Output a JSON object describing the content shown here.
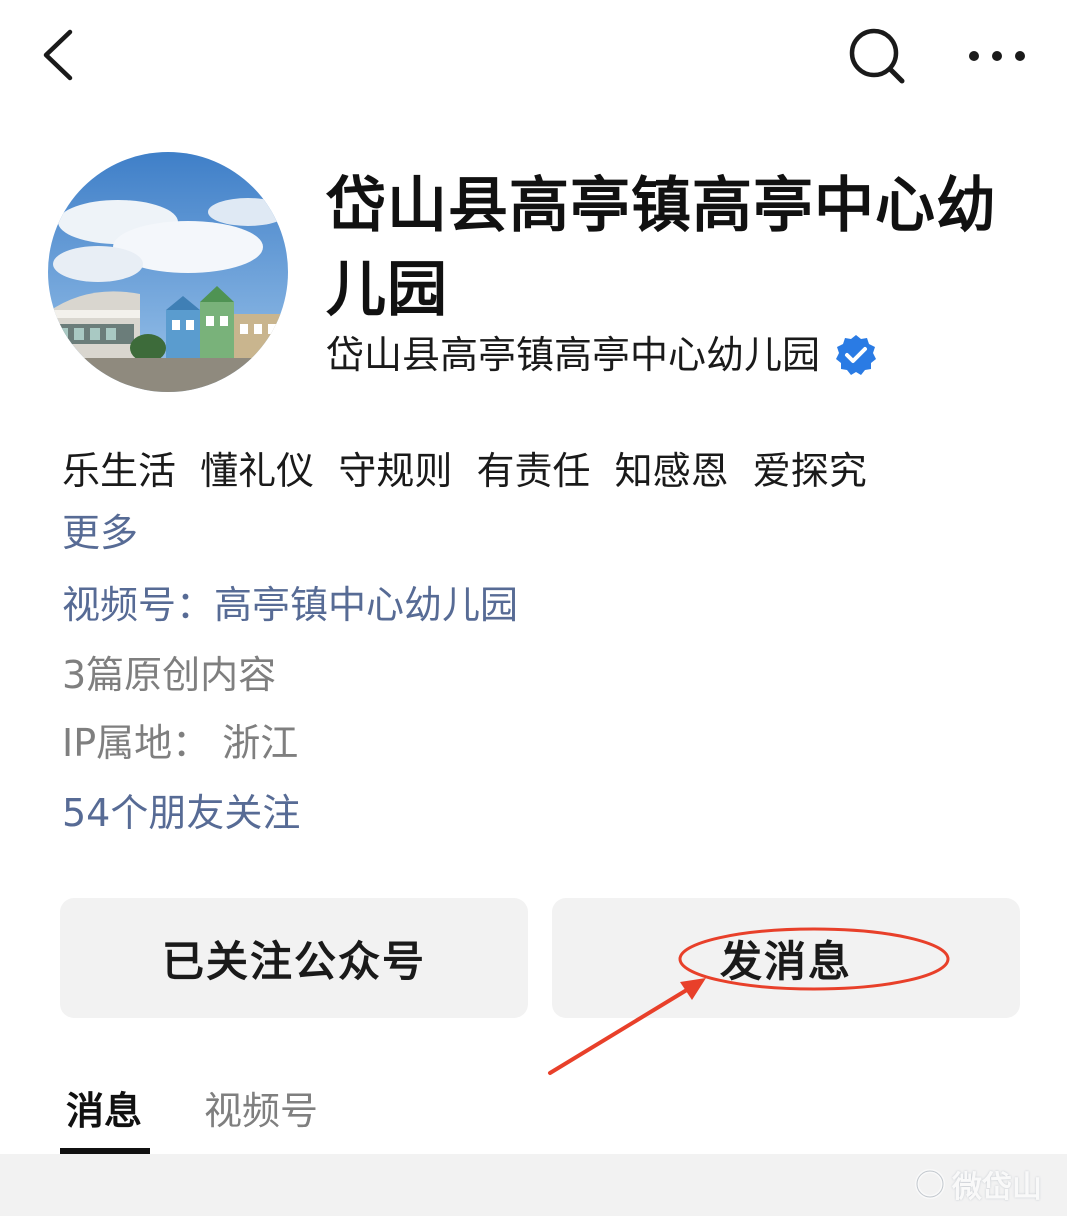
{
  "topbar": {
    "back_icon": "chevron-left-icon",
    "search_icon": "search-icon",
    "more_icon": "more-horizontal-icon"
  },
  "profile": {
    "account_name": "岱山县高亭镇高亭中心幼儿园",
    "subject_name": "岱山县高亭镇高亭中心幼儿园",
    "verified_icon": "verified-badge-icon",
    "verified_color": "#2a7be4",
    "slogan": "乐生活  懂礼仪  守规则  有责任  知感恩  爱探究",
    "more_label": "更多",
    "channel_label": "视频号：",
    "channel_name": "高亭镇中心幼儿园",
    "original_count": "3篇原创内容",
    "ip_location": "IP属地：  浙江",
    "friends_follow": "54个朋友关注"
  },
  "actions": {
    "followed_label": "已关注公众号",
    "message_label": "发消息"
  },
  "tabs": [
    {
      "label": "消息",
      "active": true
    },
    {
      "label": "视频号",
      "active": false
    }
  ],
  "annotation": {
    "color": "#e8402a",
    "shape": "ellipse-with-arrow"
  },
  "watermark": {
    "text": "微岱山"
  },
  "colors": {
    "link": "#576b95",
    "secondary_text": "#7f7f7f",
    "button_bg": "#f2f2f2"
  }
}
